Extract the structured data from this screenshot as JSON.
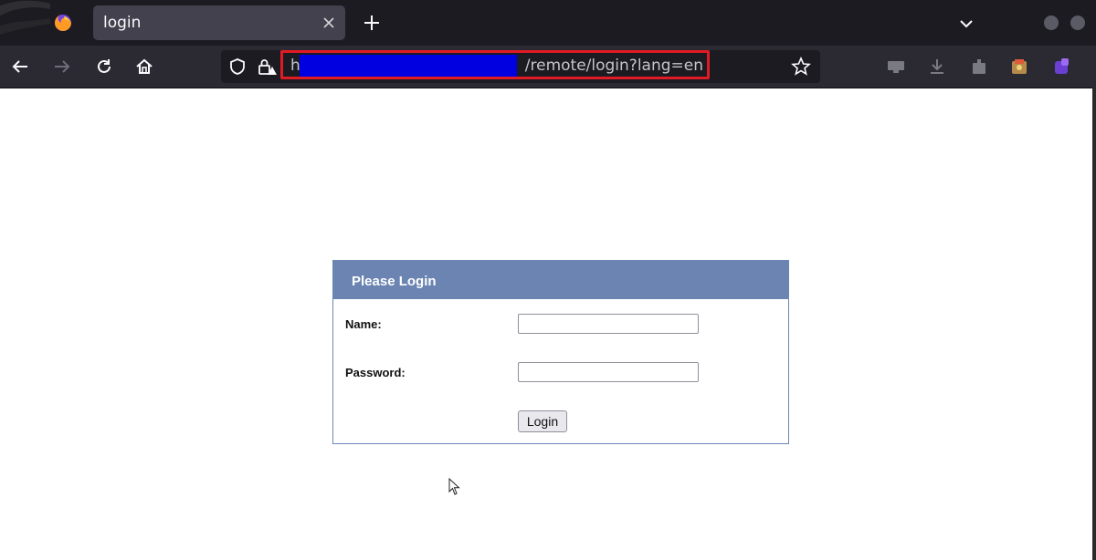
{
  "browser": {
    "tab": {
      "title": "login",
      "close_icon": "close-icon"
    },
    "new_tab_icon": "plus-icon",
    "list_tabs_icon": "chevron-down-icon",
    "nav": {
      "back_icon": "back-arrow-icon",
      "forward_icon": "forward-arrow-icon",
      "reload_icon": "reload-icon",
      "home_icon": "home-icon"
    },
    "url": {
      "prefix": "h",
      "path": "/remote/login?lang=en",
      "redaction_color": "#0000e0",
      "highlight_color": "#e01b24"
    },
    "toolbar_icons": [
      "screen-icon",
      "download-icon",
      "extension-icon",
      "addon-icon",
      "profile-icon"
    ]
  },
  "login": {
    "title": "Please Login",
    "name_label": "Name:",
    "name_value": "",
    "password_label": "Password:",
    "password_value": "",
    "button_label": "Login",
    "header_color": "#6b84b2"
  }
}
